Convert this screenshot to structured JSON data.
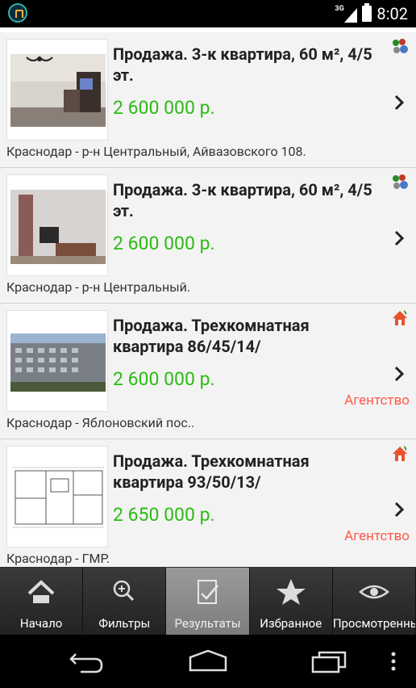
{
  "status_bar": {
    "network": "3G",
    "time": "8:02"
  },
  "listings": [
    {
      "title": "Продажа. 3-к квартира, 60 м², 4/5 эт.",
      "price": "2 600 000 р.",
      "location": "Краснодар - р-н Центральный, Айвазовского 108.",
      "agency": "",
      "type_icon": "owner-people-icon"
    },
    {
      "title": "Продажа. 3-к квартира, 60 м², 4/5 эт.",
      "price": "2 600 000 р.",
      "location": "Краснодар - р-н Центральный.",
      "agency": "",
      "type_icon": "owner-people-icon"
    },
    {
      "title": "Продажа. Трехкомнатная квартира 86/45/14/",
      "price": "2 600 000 р.",
      "location": "Краснодар - Яблоновский пос..",
      "agency": "Агентство",
      "type_icon": "agency-house-icon"
    },
    {
      "title": "Продажа. Трехкомнатная квартира 93/50/13/",
      "price": "2 650 000 р.",
      "location": "Краснодар - ГМР.",
      "agency": "Агентство",
      "type_icon": "agency-house-icon"
    }
  ],
  "tabs": [
    {
      "label": "Начало",
      "icon": "home-icon",
      "active": false
    },
    {
      "label": "Фильтры",
      "icon": "zoom-in-icon",
      "active": false
    },
    {
      "label": "Результаты",
      "icon": "results-check-icon",
      "active": true
    },
    {
      "label": "Избранное",
      "icon": "star-icon",
      "active": false
    },
    {
      "label": "Просмотренные",
      "icon": "eye-icon",
      "active": false
    }
  ],
  "colors": {
    "price": "#2bbb12",
    "agency": "#ff5a4a",
    "card_bg": "#f3f3f3",
    "tab_active": "#8c8c8c"
  }
}
